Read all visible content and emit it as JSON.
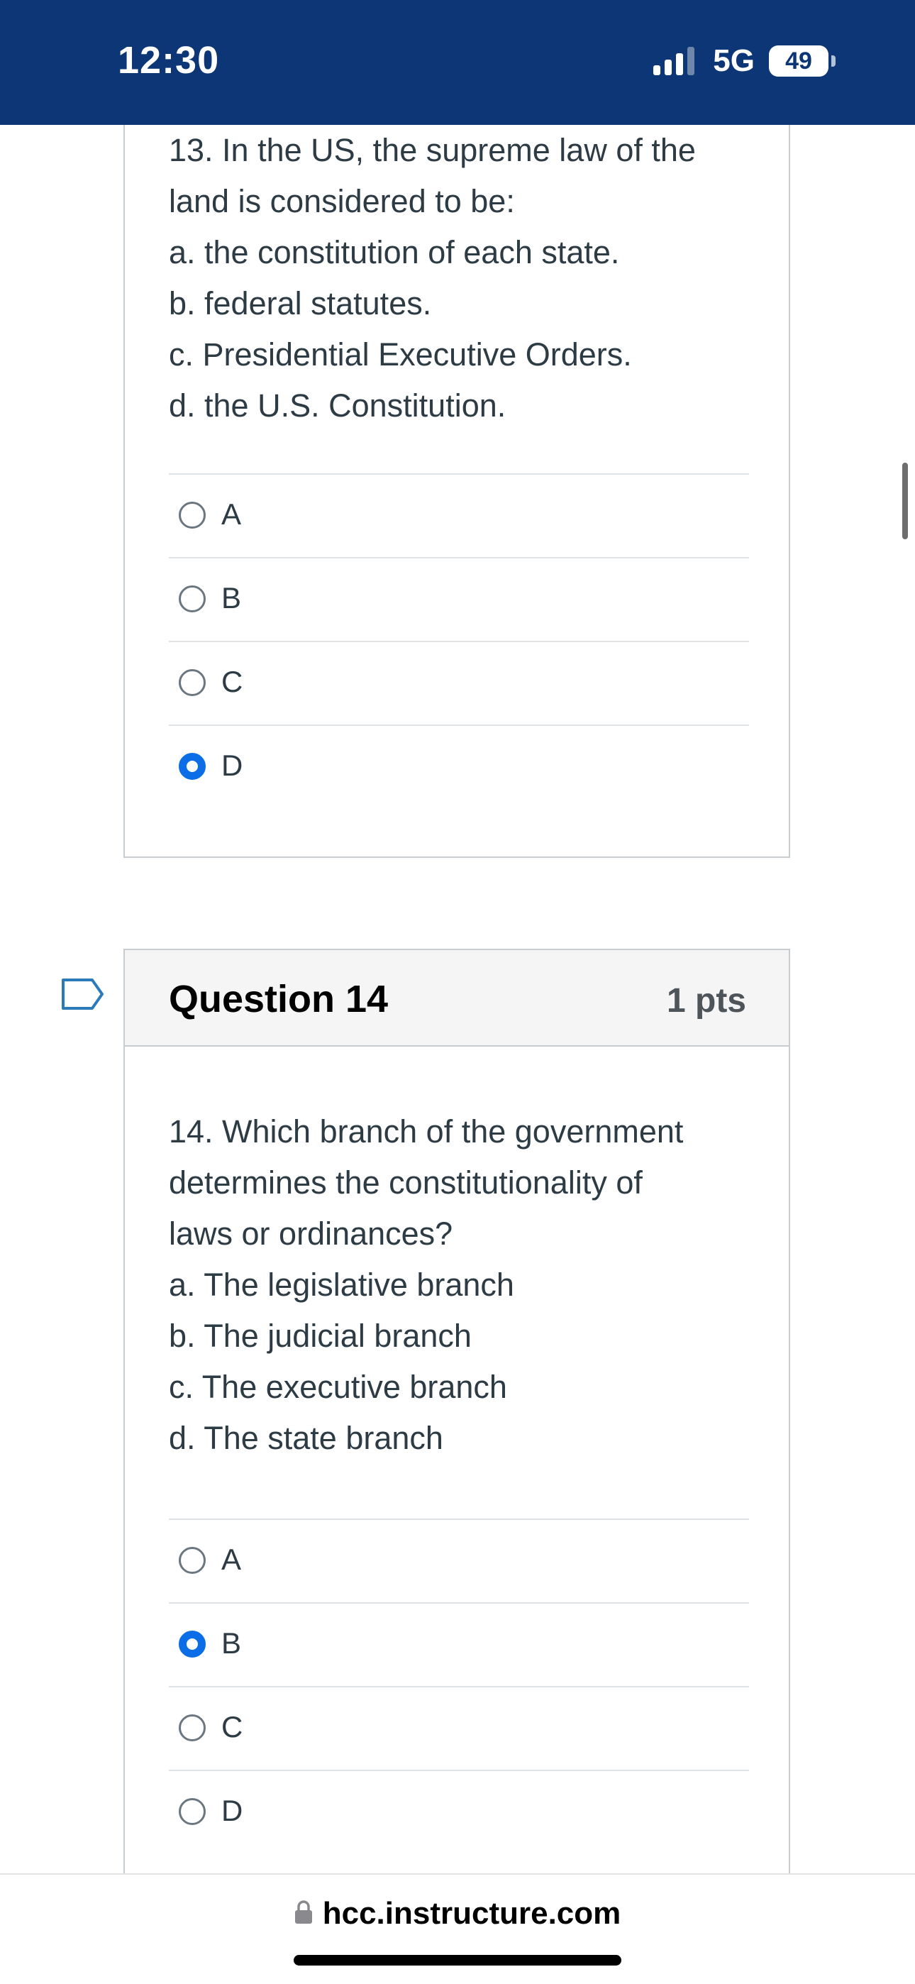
{
  "status_bar": {
    "time": "12:30",
    "network": "5G",
    "battery": "49",
    "background_color": "#0c3675"
  },
  "questions": [
    {
      "number_title": "",
      "text_lines": [
        "13. In the US, the supreme law of the",
        "land is considered to be:",
        "a. the constitution of each state.",
        "b. federal statutes.",
        "c. Presidential Executive Orders.",
        "d. the U.S. Constitution."
      ],
      "answers": [
        {
          "label": "A",
          "selected": false
        },
        {
          "label": "B",
          "selected": false
        },
        {
          "label": "C",
          "selected": false
        },
        {
          "label": "D",
          "selected": true
        }
      ]
    },
    {
      "number_title": "Question 14",
      "points": "1 pts",
      "text_lines": [
        "14. Which branch of the government",
        "determines the constitutionality of",
        "laws or ordinances?",
        "a. The legislative branch",
        "b. The judicial branch",
        "c. The executive branch",
        "d. The state branch"
      ],
      "answers": [
        {
          "label": "A",
          "selected": false
        },
        {
          "label": "B",
          "selected": true
        },
        {
          "label": "C",
          "selected": false
        },
        {
          "label": "D",
          "selected": false
        }
      ]
    }
  ],
  "icons": {
    "flag": "flag-question-icon",
    "lock": "lock-icon"
  },
  "colors": {
    "selected_radio": "#0b6ee6",
    "flag_outline": "#2b7abc"
  },
  "url_bar": {
    "domain": "hcc.instructure.com"
  }
}
